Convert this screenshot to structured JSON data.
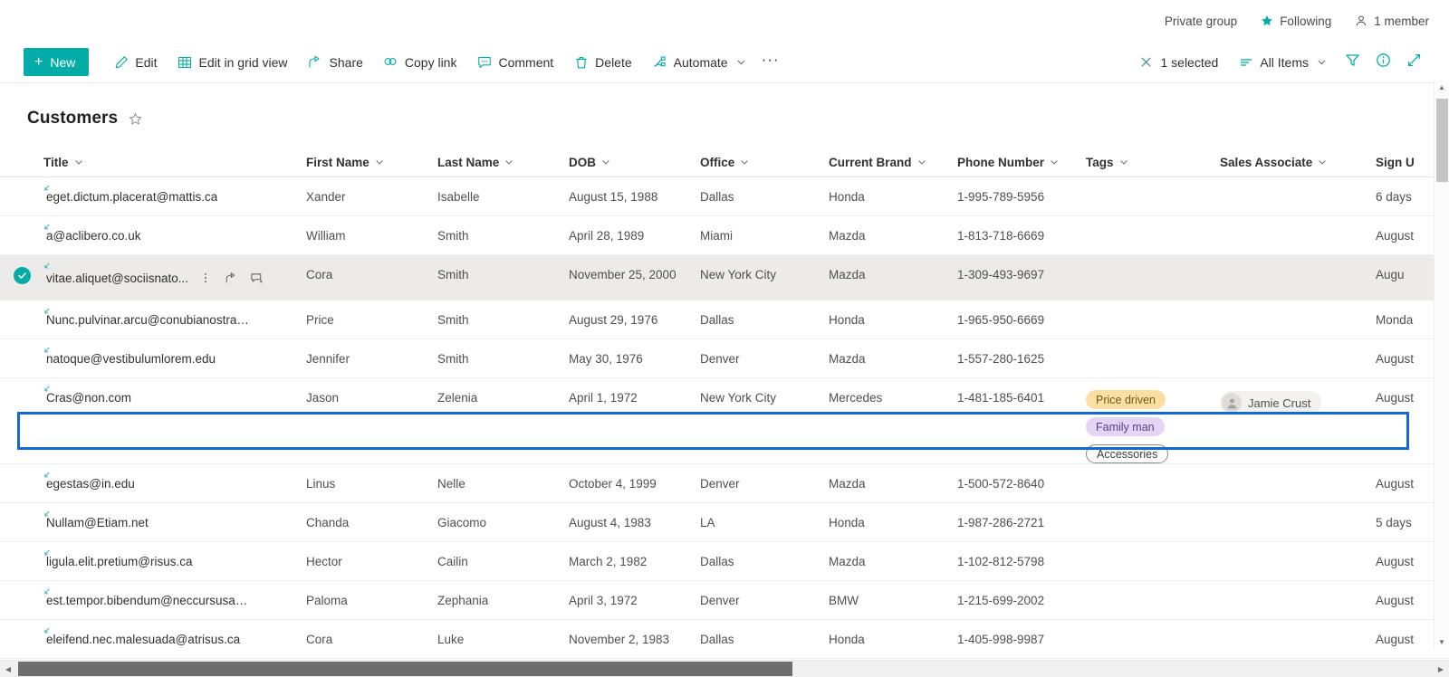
{
  "topbar": {
    "privacy_label": "Private group",
    "following_label": "Following",
    "members_label": "1 member"
  },
  "commandbar": {
    "new_label": "New",
    "items": [
      {
        "label": "Edit",
        "icon": "pencil-icon"
      },
      {
        "label": "Edit in grid view",
        "icon": "grid-icon"
      },
      {
        "label": "Share",
        "icon": "share-icon"
      },
      {
        "label": "Copy link",
        "icon": "link-icon"
      },
      {
        "label": "Comment",
        "icon": "comment-icon"
      },
      {
        "label": "Delete",
        "icon": "trash-icon"
      },
      {
        "label": "Automate",
        "icon": "automate-icon"
      }
    ],
    "overflow_label": "···",
    "selected_label": "1 selected",
    "view_label": "All Items"
  },
  "list": {
    "title": "Customers",
    "columns": [
      "Title",
      "First Name",
      "Last Name",
      "DOB",
      "Office",
      "Current Brand",
      "Phone Number",
      "Tags",
      "Sales Associate",
      "Sign U"
    ],
    "rows": [
      {
        "title": "eget.dictum.placerat@mattis.ca",
        "first": "Xander",
        "last": "Isabelle",
        "dob": "August 15, 1988",
        "office": "Dallas",
        "brand": "Honda",
        "phone": "1-995-789-5956",
        "tags": [],
        "sales": "",
        "signup": "6 days",
        "selected": false
      },
      {
        "title": "a@aclibero.co.uk",
        "first": "William",
        "last": "Smith",
        "dob": "April 28, 1989",
        "office": "Miami",
        "brand": "Mazda",
        "phone": "1-813-718-6669",
        "tags": [],
        "sales": "",
        "signup": "August",
        "selected": false
      },
      {
        "title": "vitae.aliquet@sociisnato...",
        "first": "Cora",
        "last": "Smith",
        "dob": "November 25, 2000",
        "office": "New York City",
        "brand": "Mazda",
        "phone": "1-309-493-9697",
        "tags": [],
        "sales": "",
        "signup": "Augu",
        "selected": true
      },
      {
        "title": "Nunc.pulvinar.arcu@conubianostraper.edu",
        "first": "Price",
        "last": "Smith",
        "dob": "August 29, 1976",
        "office": "Dallas",
        "brand": "Honda",
        "phone": "1-965-950-6669",
        "tags": [],
        "sales": "",
        "signup": "Monda",
        "selected": false
      },
      {
        "title": "natoque@vestibulumlorem.edu",
        "first": "Jennifer",
        "last": "Smith",
        "dob": "May 30, 1976",
        "office": "Denver",
        "brand": "Mazda",
        "phone": "1-557-280-1625",
        "tags": [],
        "sales": "",
        "signup": "August",
        "selected": false
      },
      {
        "title": "Cras@non.com",
        "first": "Jason",
        "last": "Zelenia",
        "dob": "April 1, 1972",
        "office": "New York City",
        "brand": "Mercedes",
        "phone": "1-481-185-6401",
        "tags": [
          {
            "label": "Price driven",
            "style": "amber"
          },
          {
            "label": "Family man",
            "style": "purple"
          },
          {
            "label": "Accessories",
            "style": "outline"
          }
        ],
        "sales": "Jamie Crust",
        "signup": "August",
        "selected": false,
        "tall": true
      },
      {
        "title": "egestas@in.edu",
        "first": "Linus",
        "last": "Nelle",
        "dob": "October 4, 1999",
        "office": "Denver",
        "brand": "Mazda",
        "phone": "1-500-572-8640",
        "tags": [],
        "sales": "",
        "signup": "August",
        "selected": false
      },
      {
        "title": "Nullam@Etiam.net",
        "first": "Chanda",
        "last": "Giacomo",
        "dob": "August 4, 1983",
        "office": "LA",
        "brand": "Honda",
        "phone": "1-987-286-2721",
        "tags": [],
        "sales": "",
        "signup": "5 days",
        "selected": false
      },
      {
        "title": "ligula.elit.pretium@risus.ca",
        "first": "Hector",
        "last": "Cailin",
        "dob": "March 2, 1982",
        "office": "Dallas",
        "brand": "Mazda",
        "phone": "1-102-812-5798",
        "tags": [],
        "sales": "",
        "signup": "August",
        "selected": false
      },
      {
        "title": "est.tempor.bibendum@neccursusa.com",
        "first": "Paloma",
        "last": "Zephania",
        "dob": "April 3, 1972",
        "office": "Denver",
        "brand": "BMW",
        "phone": "1-215-699-2002",
        "tags": [],
        "sales": "",
        "signup": "August",
        "selected": false
      },
      {
        "title": "eleifend.nec.malesuada@atrisus.ca",
        "first": "Cora",
        "last": "Luke",
        "dob": "November 2, 1983",
        "office": "Dallas",
        "brand": "Honda",
        "phone": "1-405-998-9987",
        "tags": [],
        "sales": "",
        "signup": "August",
        "selected": false
      }
    ]
  },
  "colors": {
    "accent_teal": "#03aca6",
    "selection_blue": "#1268d6",
    "selected_row_bg": "#edebe9",
    "tag_amber": "#fbdfa0",
    "tag_purple": "#e4d5f5"
  }
}
